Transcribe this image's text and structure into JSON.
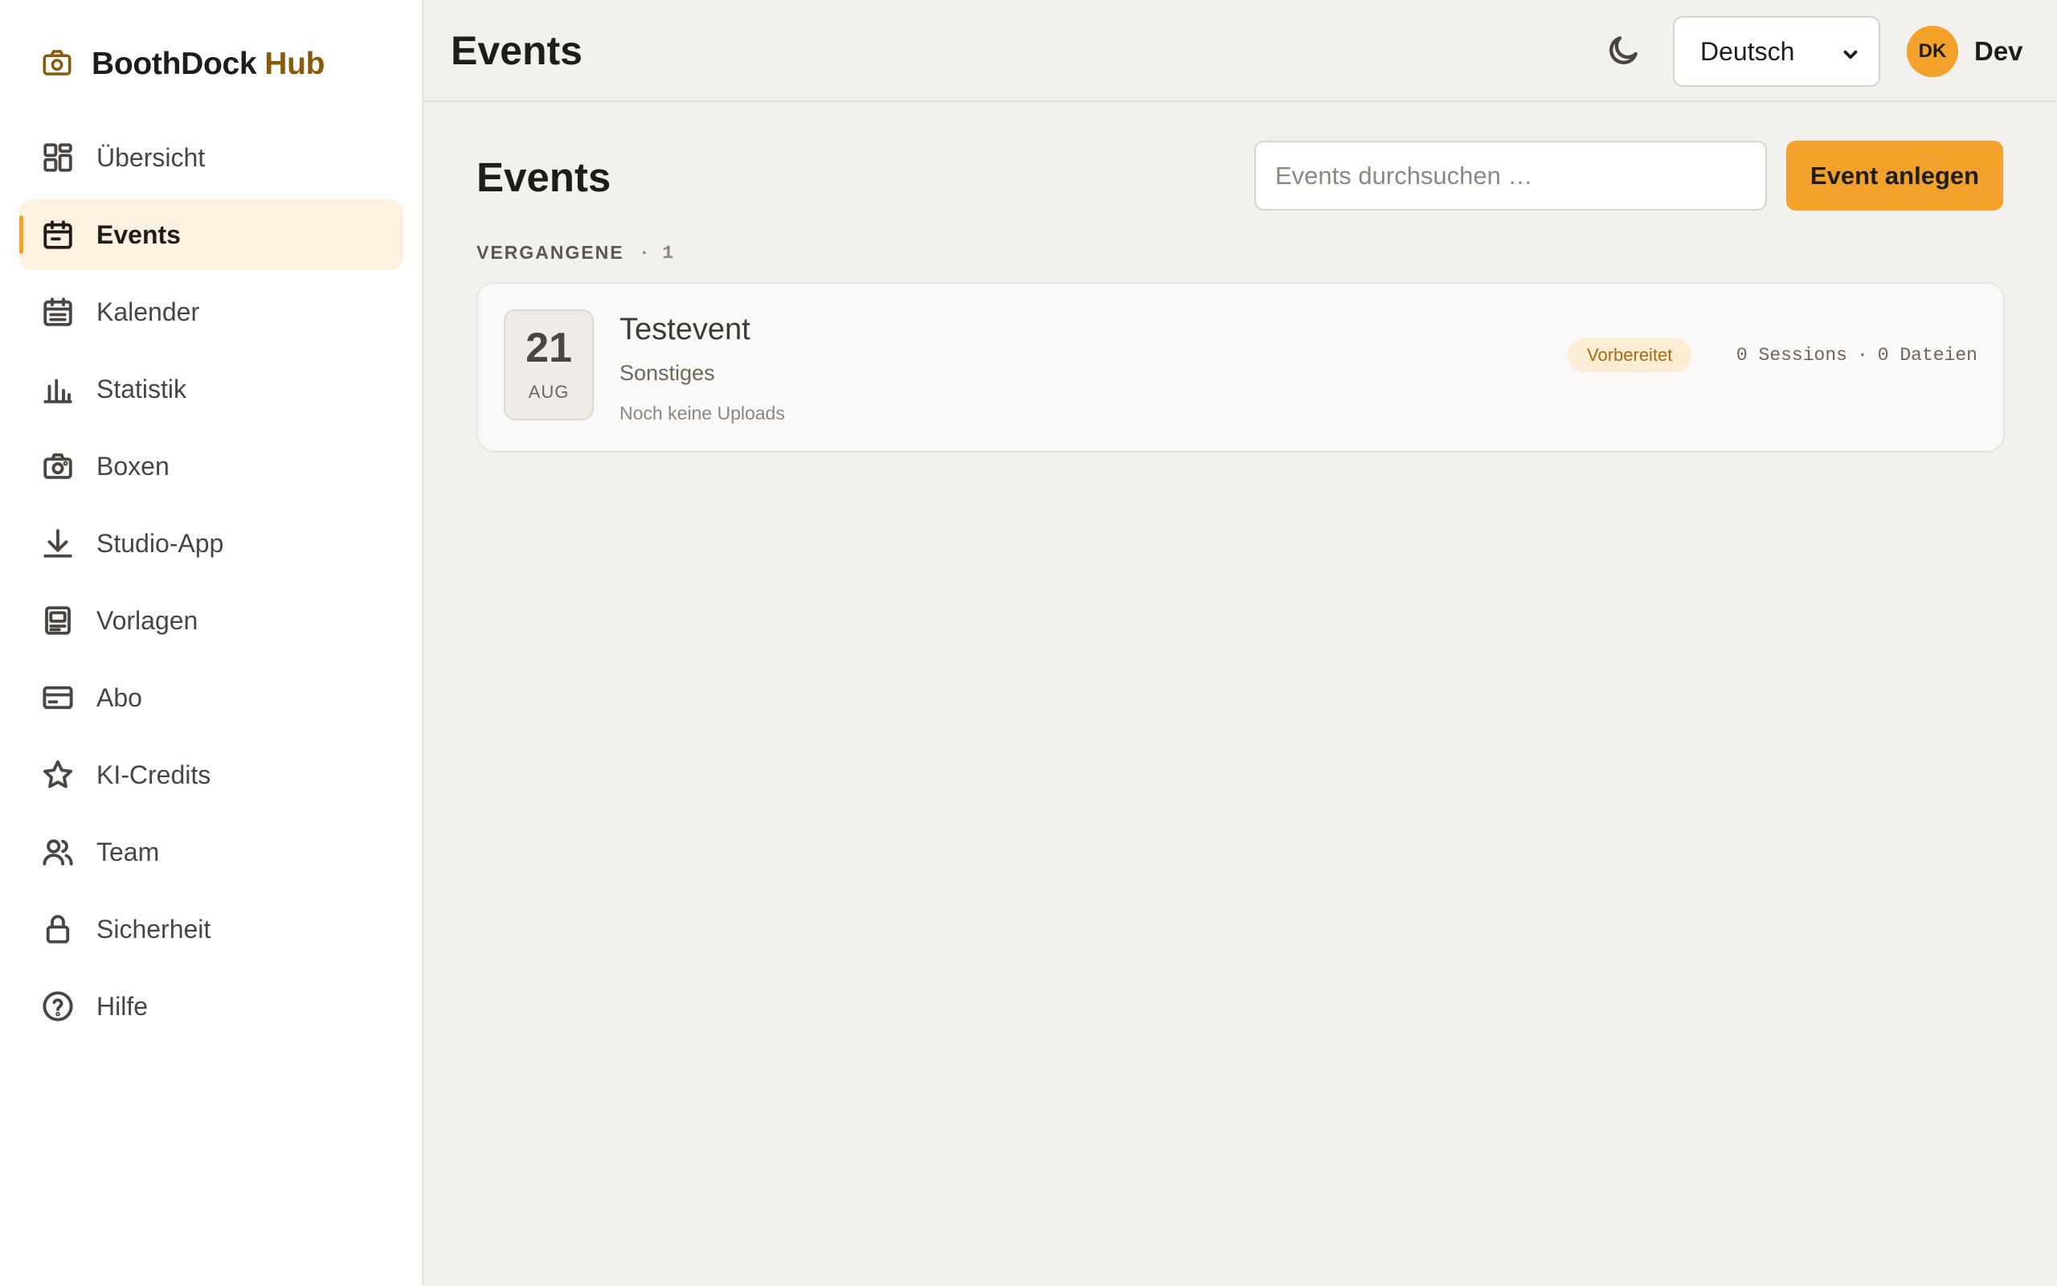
{
  "brand": {
    "name": "BoothDock",
    "accent": "Hub",
    "icon": "camera-icon"
  },
  "sidebar": {
    "items": [
      {
        "label": "Übersicht",
        "icon": "dashboard-grid-icon"
      },
      {
        "label": "Events",
        "icon": "calendar-icon",
        "active": true
      },
      {
        "label": "Kalender",
        "icon": "calendar-list-icon"
      },
      {
        "label": "Statistik",
        "icon": "bar-chart-icon"
      },
      {
        "label": "Boxen",
        "icon": "camera-icon"
      },
      {
        "label": "Studio-App",
        "icon": "download-icon"
      },
      {
        "label": "Vorlagen",
        "icon": "template-icon"
      },
      {
        "label": "Abo",
        "icon": "credit-card-icon"
      },
      {
        "label": "KI-Credits",
        "icon": "star-icon"
      },
      {
        "label": "Team",
        "icon": "users-icon"
      },
      {
        "label": "Sicherheit",
        "icon": "lock-icon"
      },
      {
        "label": "Hilfe",
        "icon": "help-circle-icon"
      }
    ]
  },
  "header": {
    "title": "Events",
    "theme_icon": "moon-icon",
    "language": {
      "selected": "Deutsch"
    },
    "user": {
      "initials": "DK",
      "name": "Dev"
    }
  },
  "main": {
    "heading": "Events",
    "search": {
      "placeholder": "Events durchsuchen …",
      "value": ""
    },
    "create_button": "Event anlegen",
    "section": {
      "label": "VERGANGENE",
      "separator": "·",
      "count": "1"
    },
    "events": [
      {
        "day": "21",
        "month": "AUG",
        "title": "Testevent",
        "category": "Sonstiges",
        "uploads": "Noch keine Uploads",
        "status": "Vorbereitet",
        "sessions": "0 Sessions",
        "separator": "·",
        "files": "0 Dateien"
      }
    ]
  },
  "colors": {
    "accent": "#f2a22a",
    "brand_accent": "#8a5a0c",
    "background": "#f3f1ee",
    "sidebar_bg": "#ffffff",
    "active_bg": "#fdf1e0",
    "badge_bg": "#fbecd3",
    "badge_text": "#a46d14"
  }
}
